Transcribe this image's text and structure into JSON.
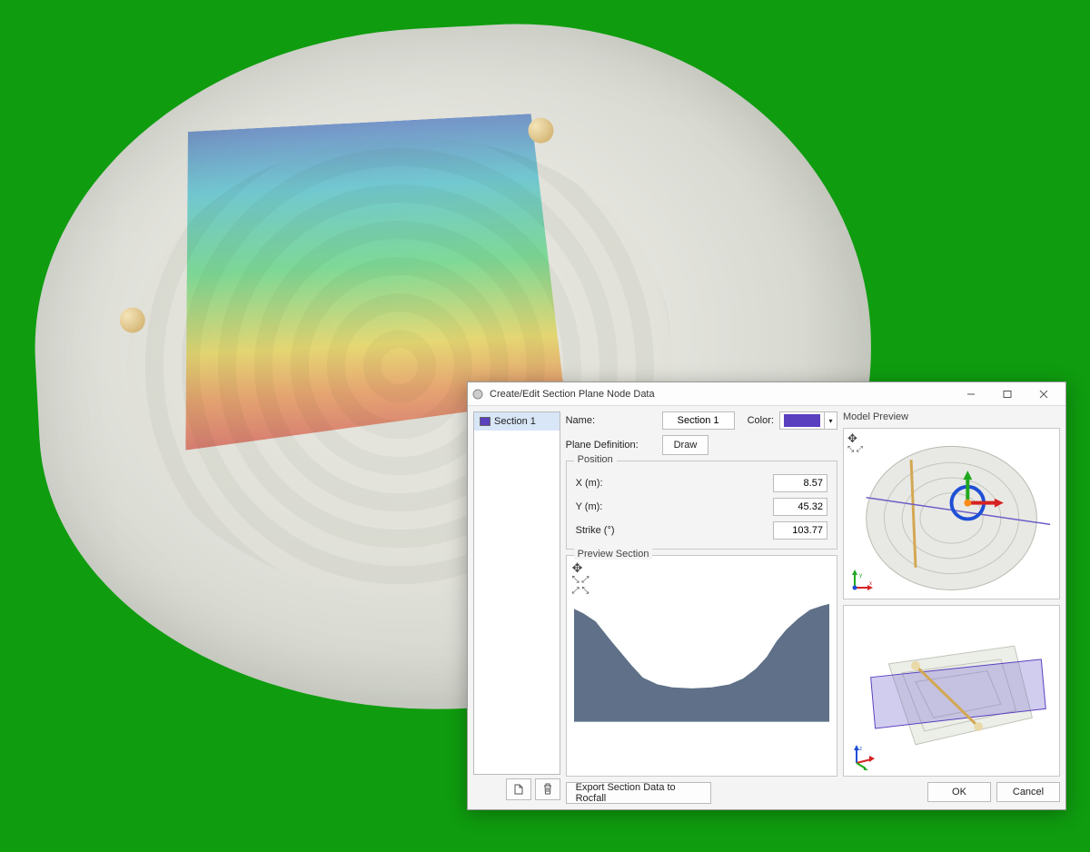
{
  "dialog": {
    "title": "Create/Edit Section Plane Node Data",
    "sections_list": [
      {
        "label": "Section 1",
        "color": "#5a3fbf"
      }
    ],
    "name_label": "Name:",
    "name_value": "Section 1",
    "color_label": "Color:",
    "color_value": "#5a3fbf",
    "plane_def_label": "Plane Definition:",
    "draw_button": "Draw",
    "position": {
      "legend": "Position",
      "x_label": "X (m):",
      "x_value": "8.57",
      "y_label": "Y (m):",
      "y_value": "45.32",
      "strike_label": "Strike (°)",
      "strike_value": "103.77"
    },
    "preview_section_legend": "Preview Section",
    "export_button": "Export Section Data to Rocfall",
    "model_preview_label": "Model Preview",
    "ok_button": "OK",
    "cancel_button": "Cancel"
  }
}
